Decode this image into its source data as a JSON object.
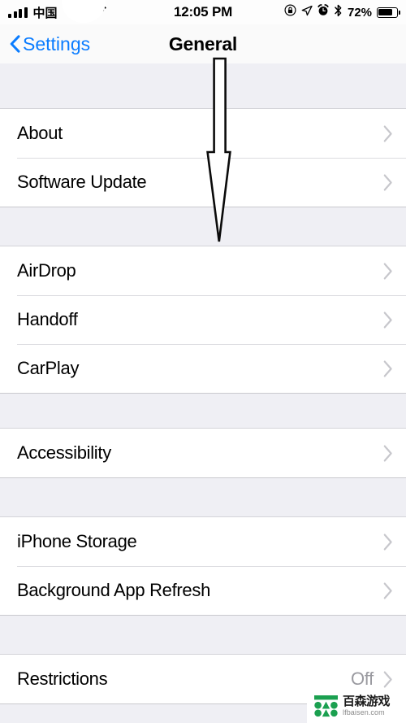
{
  "status_bar": {
    "carrier": "中国",
    "signal_icon": "signal-bars-icon",
    "wifi_icon": "wifi-icon",
    "time": "12:05 PM",
    "rotation_lock_icon": "rotation-lock-icon",
    "location_icon": "location-arrow-icon",
    "alarm_icon": "alarm-clock-icon",
    "bluetooth_icon": "bluetooth-icon",
    "battery_percent": "72%",
    "battery_icon": "battery-icon",
    "battery_level": 72
  },
  "nav_bar": {
    "back_label": "Settings",
    "back_icon": "chevron-left-icon",
    "title": "General"
  },
  "list": {
    "groups": [
      {
        "rows": [
          {
            "label": "About",
            "value": "",
            "accessory": "chevron-right-icon"
          },
          {
            "label": "Software Update",
            "value": "",
            "accessory": "chevron-right-icon"
          }
        ]
      },
      {
        "rows": [
          {
            "label": "AirDrop",
            "value": "",
            "accessory": "chevron-right-icon"
          },
          {
            "label": "Handoff",
            "value": "",
            "accessory": "chevron-right-icon"
          },
          {
            "label": "CarPlay",
            "value": "",
            "accessory": "chevron-right-icon"
          }
        ]
      },
      {
        "rows": [
          {
            "label": "Accessibility",
            "value": "",
            "accessory": "chevron-right-icon"
          }
        ]
      },
      {
        "rows": [
          {
            "label": "iPhone Storage",
            "value": "",
            "accessory": "chevron-right-icon"
          },
          {
            "label": "Background App Refresh",
            "value": "",
            "accessory": "chevron-right-icon"
          }
        ]
      },
      {
        "rows": [
          {
            "label": "Restrictions",
            "value": "Off",
            "accessory": "chevron-right-icon"
          }
        ]
      }
    ]
  },
  "annotation": {
    "arrow_icon": "down-arrow-annotation",
    "arrow_outline_color": "#000000",
    "arrow_fill_color": "#FFFFFF"
  },
  "watermark": {
    "logo_icon": "baisen-logo-icon",
    "title": "百森游戏",
    "subtitle": "lfbaisen.com",
    "brand_color": "#1BA050"
  },
  "colors": {
    "accent_blue": "#0A7CFF",
    "group_background": "#EFEFF4",
    "row_background": "#FFFFFF",
    "separator": "#DCDCE0",
    "secondary_text": "#9A9AA0",
    "chevron": "#C7C7CC"
  }
}
